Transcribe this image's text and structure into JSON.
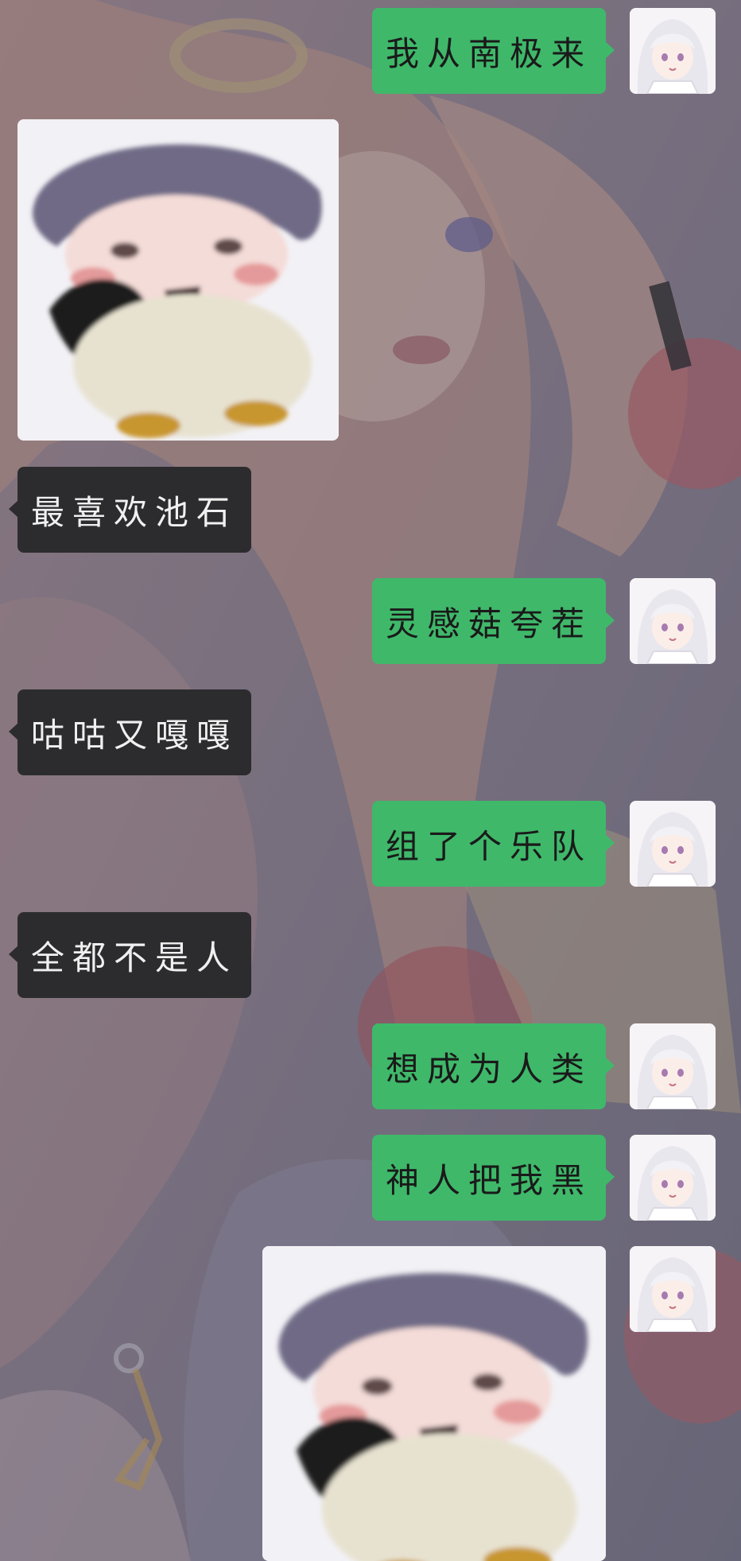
{
  "chat": {
    "messages": [
      {
        "side": "out",
        "text": "我从南极来"
      },
      {
        "side": "in",
        "sticker": "penguin-girl-sticker"
      },
      {
        "side": "in",
        "text": "最喜欢池石"
      },
      {
        "side": "out",
        "text": "灵感菇夸茬"
      },
      {
        "side": "in",
        "text": "咕咕又嘎嘎"
      },
      {
        "side": "out",
        "text": "组了个乐队"
      },
      {
        "side": "in",
        "text": "全都不是人"
      },
      {
        "side": "out",
        "text": "想成为人类"
      },
      {
        "side": "out",
        "text": "神人把我黑"
      },
      {
        "side": "out",
        "sticker": "penguin-girl-sticker"
      }
    ]
  },
  "colors": {
    "outgoing_bubble": "#3fb86a",
    "incoming_bubble": "#2c2c2e"
  },
  "icons": {
    "avatar": "white-haired-girl-avatar",
    "sticker": "penguin-girl-sticker"
  }
}
